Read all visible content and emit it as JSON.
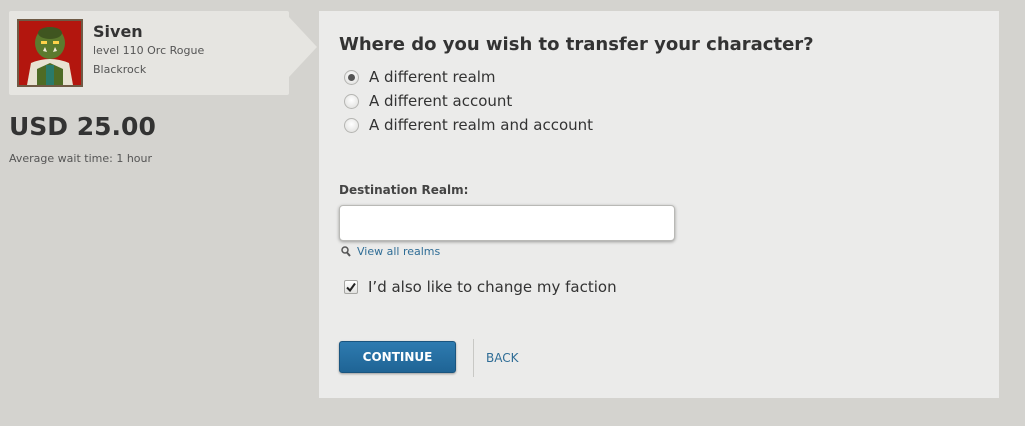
{
  "character": {
    "name": "Siven",
    "details": "level 110 Orc Rogue",
    "realm": "Blackrock"
  },
  "price": "USD 25.00",
  "wait_time": "Average wait time: 1 hour",
  "form": {
    "question": "Where do you wish to transfer your character?",
    "options": [
      {
        "label": "A different realm",
        "selected": true
      },
      {
        "label": "A different account",
        "selected": false
      },
      {
        "label": "A different realm and account",
        "selected": false
      }
    ],
    "destination_label": "Destination Realm:",
    "destination_value": "",
    "view_all_label": "View all realms",
    "faction_label": "I’d also like to change my faction",
    "faction_checked": true,
    "continue_label": "CONTINUE",
    "back_label": "BACK"
  },
  "colors": {
    "accent": "#1f6495",
    "link": "#2f6d96",
    "background": "#d4d3cf",
    "panel": "#ebebea"
  },
  "icons": {
    "view_all": "magnifier-icon",
    "faction": "checkmark-icon"
  }
}
